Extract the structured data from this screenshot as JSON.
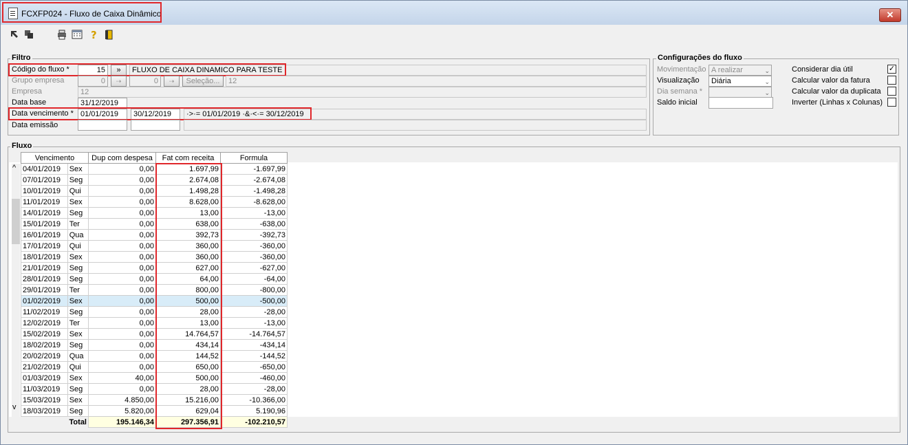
{
  "window": {
    "title": "FCXFP024 - Fluxo de Caixa Dinâmico",
    "close": "✕"
  },
  "toolbar": {
    "icons": [
      "arrow-icon",
      "copy-icon",
      "print-icon",
      "calendar-icon",
      "help-icon",
      "exit-door-icon"
    ]
  },
  "filtro": {
    "legend": "Filtro",
    "codigo_label": "Código do fluxo *",
    "codigo_value": "15",
    "codigo_btn": "»",
    "codigo_desc": "FLUXO DE CAIXA DINAMICO PARA TESTE",
    "grupo_label": "Grupo empresa",
    "grupo_v1": "0",
    "grupo_v2": "0",
    "grupo_btn": "Seleção...",
    "grupo_count": "12",
    "empresa_label": "Empresa",
    "empresa_value": "12",
    "database_label": "Data base",
    "database_value": "31/12/2019",
    "venc_label": "Data vencimento *",
    "venc_from": "01/01/2019",
    "venc_to": "30/12/2019",
    "venc_expr": "·>·= 01/01/2019 ·&·<·= 30/12/2019",
    "emissao_label": "Data emissão",
    "emissao_from": "",
    "emissao_to": ""
  },
  "config": {
    "legend": "Configurações do fluxo",
    "mov_label": "Movimentação",
    "mov_value": "A realizar",
    "vis_label": "Visualização",
    "vis_value": "Diária",
    "dia_label": "Dia semana *",
    "dia_value": "",
    "saldo_label": "Saldo inicial",
    "saldo_value": "",
    "checks": [
      {
        "label": "Considerar dia útil",
        "checked": "✓"
      },
      {
        "label": "Calcular valor da fatura",
        "checked": ""
      },
      {
        "label": "Calcular valor da duplicata",
        "checked": ""
      },
      {
        "label": "Inverter (Linhas x Colunas)",
        "checked": ""
      }
    ]
  },
  "fluxo": {
    "legend": "Fluxo",
    "columns": [
      "Vencimento",
      "Dup com despesa",
      "Fat com receita",
      "Formula"
    ],
    "rows": [
      [
        "04/01/2019",
        "Sex",
        "0,00",
        "1.697,99",
        "-1.697,99"
      ],
      [
        "07/01/2019",
        "Seg",
        "0,00",
        "2.674,08",
        "-2.674,08"
      ],
      [
        "10/01/2019",
        "Qui",
        "0,00",
        "1.498,28",
        "-1.498,28"
      ],
      [
        "11/01/2019",
        "Sex",
        "0,00",
        "8.628,00",
        "-8.628,00"
      ],
      [
        "14/01/2019",
        "Seg",
        "0,00",
        "13,00",
        "-13,00"
      ],
      [
        "15/01/2019",
        "Ter",
        "0,00",
        "638,00",
        "-638,00"
      ],
      [
        "16/01/2019",
        "Qua",
        "0,00",
        "392,73",
        "-392,73"
      ],
      [
        "17/01/2019",
        "Qui",
        "0,00",
        "360,00",
        "-360,00"
      ],
      [
        "18/01/2019",
        "Sex",
        "0,00",
        "360,00",
        "-360,00"
      ],
      [
        "21/01/2019",
        "Seg",
        "0,00",
        "627,00",
        "-627,00"
      ],
      [
        "28/01/2019",
        "Seg",
        "0,00",
        "64,00",
        "-64,00"
      ],
      [
        "29/01/2019",
        "Ter",
        "0,00",
        "800,00",
        "-800,00"
      ],
      [
        "01/02/2019",
        "Sex",
        "0,00",
        "500,00",
        "-500,00"
      ],
      [
        "11/02/2019",
        "Seg",
        "0,00",
        "28,00",
        "-28,00"
      ],
      [
        "12/02/2019",
        "Ter",
        "0,00",
        "13,00",
        "-13,00"
      ],
      [
        "15/02/2019",
        "Sex",
        "0,00",
        "14.764,57",
        "-14.764,57"
      ],
      [
        "18/02/2019",
        "Seg",
        "0,00",
        "434,14",
        "-434,14"
      ],
      [
        "20/02/2019",
        "Qua",
        "0,00",
        "144,52",
        "-144,52"
      ],
      [
        "21/02/2019",
        "Qui",
        "0,00",
        "650,00",
        "-650,00"
      ],
      [
        "01/03/2019",
        "Sex",
        "40,00",
        "500,00",
        "-460,00"
      ],
      [
        "11/03/2019",
        "Seg",
        "0,00",
        "28,00",
        "-28,00"
      ],
      [
        "15/03/2019",
        "Sex",
        "4.850,00",
        "15.216,00",
        "-10.366,00"
      ],
      [
        "18/03/2019",
        "Seg",
        "5.820,00",
        "629,04",
        "5.190,96"
      ]
    ],
    "selected_row": 12,
    "total_label": "Total",
    "total_dup": "195.146,34",
    "total_fat": "297.356,91",
    "total_formula": "-102.210,57"
  }
}
